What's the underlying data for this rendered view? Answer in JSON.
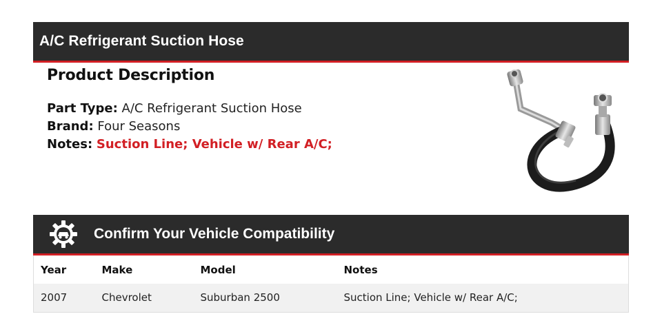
{
  "product_title": "A/C Refrigerant Suction Hose",
  "description": {
    "heading": "Product Description",
    "part_type_label": "Part Type:",
    "part_type_value": "A/C Refrigerant Suction Hose",
    "brand_label": "Brand:",
    "brand_value": "Four Seasons",
    "notes_label": "Notes:",
    "notes_value": "Suction Line; Vehicle w/ Rear A/C;"
  },
  "compatibility": {
    "heading": "Confirm Your Vehicle Compatibility",
    "icon": "gear-car-icon",
    "columns": [
      "Year",
      "Make",
      "Model",
      "Notes"
    ],
    "rows": [
      [
        "2007",
        "Chevrolet",
        "Suburban 2500",
        "Suction Line; Vehicle w/ Rear A/C;"
      ]
    ]
  },
  "colors": {
    "header_bg": "#2b2b2b",
    "accent_red": "#d21f24"
  }
}
